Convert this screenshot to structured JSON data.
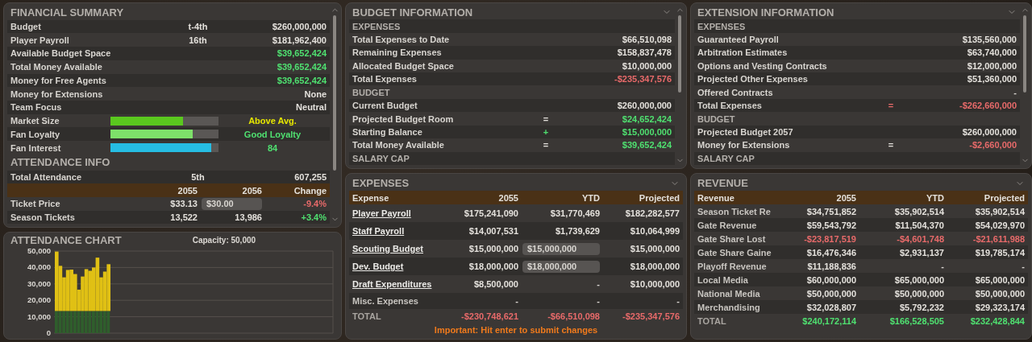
{
  "financial_summary": {
    "title": "FINANCIAL SUMMARY",
    "rows": [
      {
        "kind": "value",
        "label": "Budget",
        "rank": "t-4th",
        "value": "$260,000,000",
        "color": "#e4e1dc"
      },
      {
        "kind": "value",
        "label": "Player Payroll",
        "rank": "16th",
        "value": "$181,962,400",
        "color": "#e4e1dc"
      },
      {
        "kind": "value",
        "label": "Available Budget Space",
        "value": "$39,652,424",
        "color": "#4fe070"
      },
      {
        "kind": "value",
        "label": "Total Money Available",
        "value": "$39,652,424",
        "color": "#4fe070"
      },
      {
        "kind": "value",
        "label": "Money for Free Agents",
        "value": "$39,652,424",
        "color": "#4fe070"
      },
      {
        "kind": "value",
        "label": "Money for Extensions",
        "value": "None",
        "color": "#e4e1dc"
      },
      {
        "kind": "value",
        "label": "Team Focus",
        "value": "Neutral",
        "color": "#e4e1dc"
      },
      {
        "kind": "meter",
        "label": "Market Size",
        "level": 0.67,
        "color": "#5ac81e",
        "rating": {
          "text": "Above Avg.",
          "color": "#e6e600"
        }
      },
      {
        "kind": "meter",
        "label": "Fan Loyalty",
        "level": 0.76,
        "color": "#7ee06a",
        "rating": {
          "text": "Good Loyalty",
          "color": "#4fe070"
        }
      },
      {
        "kind": "meter",
        "label": "Fan Interest",
        "level": 0.93,
        "color": "#26bde3",
        "rating": {
          "text": "84",
          "color": "#4fe070"
        }
      },
      {
        "kind": "section",
        "label": "ATTENDANCE INFO"
      },
      {
        "kind": "value",
        "label": "Total Attendance",
        "rank": "5th",
        "value": "607,255",
        "color": "#e4e1dc"
      }
    ],
    "attendance_table": {
      "columns": [
        "2055",
        "2056",
        "Change"
      ],
      "rows": [
        {
          "label": "Ticket Price",
          "cells": [
            {
              "kind": "text",
              "text": "$33.13",
              "color": "#e4e1dc"
            },
            {
              "kind": "input",
              "text": "$30.00"
            },
            {
              "kind": "text",
              "text": "-9.4%",
              "color": "#e86a6a"
            }
          ]
        },
        {
          "label": "Season Tickets",
          "cells": [
            {
              "kind": "text",
              "text": "13,522",
              "color": "#e4e1dc"
            },
            {
              "kind": "text",
              "text": "13,986",
              "color": "#e4e1dc"
            },
            {
              "kind": "text",
              "text": "+3.4%",
              "color": "#4fe070"
            }
          ]
        }
      ]
    }
  },
  "attendance_chart": {
    "title": "ATTENDANCE CHART",
    "capacity": "Capacity: 50,000",
    "chart_data": {
      "type": "bar",
      "stacked": true,
      "grid": true,
      "ylim": [
        0,
        50000
      ],
      "yticks": [
        {
          "value": 0,
          "label": "0"
        },
        {
          "value": 10000,
          "label": "10,000"
        },
        {
          "value": 20000,
          "label": "20,000"
        },
        {
          "value": 30000,
          "label": "30,000"
        },
        {
          "value": 40000,
          "label": "40,000"
        },
        {
          "value": 50000,
          "label": "50,000"
        }
      ],
      "series": [
        {
          "color": "#2f5e2c",
          "values": [
            13500,
            13500,
            13500,
            13500,
            13500,
            13500,
            13500,
            13500,
            13500,
            13500,
            13500,
            13500,
            13500,
            13500,
            13500
          ]
        },
        {
          "color": "#e0c014",
          "values": [
            36200,
            27500,
            20500,
            25000,
            25200,
            22500,
            13000,
            21000,
            25500,
            24500,
            26500,
            32500,
            20500,
            24000,
            28500
          ]
        }
      ]
    }
  },
  "budget_information": {
    "title": "BUDGET INFORMATION",
    "rows": [
      {
        "kind": "section",
        "label": "EXPENSES"
      },
      {
        "kind": "line",
        "label": "Total Expenses to Date",
        "value": "$66,510,098",
        "color": "#e4e1dc"
      },
      {
        "kind": "line",
        "label": "Remaining Expenses",
        "value": "$158,837,478",
        "color": "#e4e1dc"
      },
      {
        "kind": "line",
        "label": "Allocated Budget Space",
        "value": "$10,000,000",
        "color": "#e4e1dc"
      },
      {
        "kind": "line",
        "label": "Total Expenses",
        "value": "-$235,347,576",
        "color": "#e86a6a"
      },
      {
        "kind": "section",
        "label": "BUDGET"
      },
      {
        "kind": "line",
        "label": "Current Budget",
        "value": "$260,000,000",
        "color": "#e4e1dc"
      },
      {
        "kind": "line",
        "label": "Projected Budget Room",
        "op": {
          "text": "=",
          "color": "#e4e1dc"
        },
        "value": "$24,652,424",
        "color": "#4fe070"
      },
      {
        "kind": "line",
        "label": "Starting Balance",
        "op": {
          "text": "+",
          "color": "#4fe070"
        },
        "value": "$15,000,000",
        "color": "#4fe070"
      },
      {
        "kind": "line",
        "label": "Total Money Available",
        "op": {
          "text": "=",
          "color": "#e4e1dc"
        },
        "value": "$39,652,424",
        "color": "#4fe070"
      },
      {
        "kind": "section",
        "label": "SALARY CAP"
      }
    ]
  },
  "extension_information": {
    "title": "EXTENSION INFORMATION",
    "rows": [
      {
        "kind": "section",
        "label": "EXPENSES"
      },
      {
        "kind": "line",
        "label": "Guaranteed Payroll",
        "value": "$135,560,000",
        "color": "#e4e1dc"
      },
      {
        "kind": "line",
        "label": "Arbitration Estimates",
        "value": "$63,740,000",
        "color": "#e4e1dc"
      },
      {
        "kind": "line",
        "label": "Options and Vesting Contracts",
        "value": "$12,000,000",
        "color": "#e4e1dc"
      },
      {
        "kind": "line",
        "label": "Projected Other Expenses",
        "value": "$51,360,000",
        "color": "#e4e1dc"
      },
      {
        "kind": "line",
        "label": "Offered Contracts",
        "value": "-"
      },
      {
        "kind": "line",
        "label": "Total Expenses",
        "op": {
          "text": "=",
          "color": "#e86a6a"
        },
        "value": "-$262,660,000",
        "color": "#e86a6a"
      },
      {
        "kind": "section",
        "label": "BUDGET"
      },
      {
        "kind": "line",
        "label": "Projected Budget 2057",
        "value": "$260,000,000",
        "color": "#e4e1dc"
      },
      {
        "kind": "line",
        "label": "Money for Extensions",
        "op": {
          "text": "=",
          "color": "#e4e1dc"
        },
        "value": "-$2,660,000",
        "color": "#e86a6a"
      },
      {
        "kind": "section",
        "label": "SALARY CAP"
      }
    ]
  },
  "expenses": {
    "title": "EXPENSES",
    "label_column": "Expense",
    "columns": [
      "2055",
      "YTD",
      "Projected"
    ],
    "rows": [
      {
        "kind": "link",
        "label": "Player Payroll",
        "cells": [
          {
            "kind": "text",
            "text": "$175,241,090",
            "color": "#e4e1dc"
          },
          {
            "kind": "text",
            "text": "$31,770,469",
            "color": "#e4e1dc"
          },
          {
            "kind": "text",
            "text": "$182,282,577",
            "color": "#e4e1dc"
          }
        ]
      },
      {
        "kind": "link",
        "label": "Staff Payroll",
        "cells": [
          {
            "kind": "text",
            "text": "$14,007,531",
            "color": "#e4e1dc"
          },
          {
            "kind": "text",
            "text": "$1,739,629",
            "color": "#e4e1dc"
          },
          {
            "kind": "text",
            "text": "$10,064,999",
            "color": "#e4e1dc"
          }
        ]
      },
      {
        "kind": "link",
        "label": "Scouting Budget",
        "cells": [
          {
            "kind": "text",
            "text": "$15,000,000",
            "color": "#e4e1dc"
          },
          {
            "kind": "input",
            "text": "$15,000,000"
          },
          {
            "kind": "text",
            "text": "$15,000,000",
            "color": "#e4e1dc"
          }
        ]
      },
      {
        "kind": "link",
        "label": "Dev. Budget",
        "cells": [
          {
            "kind": "text",
            "text": "$18,000,000",
            "color": "#e4e1dc"
          },
          {
            "kind": "input",
            "text": "$18,000,000"
          },
          {
            "kind": "text",
            "text": "$18,000,000",
            "color": "#e4e1dc"
          }
        ]
      },
      {
        "kind": "link",
        "label": "Draft Expenditures",
        "cells": [
          {
            "kind": "text",
            "text": "$8,500,000",
            "color": "#e4e1dc"
          },
          {
            "kind": "text",
            "text": "-"
          },
          {
            "kind": "text",
            "text": "$10,000,000",
            "color": "#e4e1dc"
          }
        ]
      },
      {
        "kind": "plain",
        "label": "Misc. Expenses",
        "cells": [
          {
            "kind": "text",
            "text": "-"
          },
          {
            "kind": "text",
            "text": "-"
          },
          {
            "kind": "text",
            "text": "-"
          }
        ]
      },
      {
        "kind": "total",
        "label": "TOTAL",
        "cells": [
          {
            "kind": "text",
            "text": "-$230,748,621",
            "color": "#e86a6a"
          },
          {
            "kind": "text",
            "text": "-$66,510,098",
            "color": "#e86a6a"
          },
          {
            "kind": "text",
            "text": "-$235,347,576",
            "color": "#e86a6a"
          }
        ]
      }
    ],
    "note": "Important: Hit enter to submit changes"
  },
  "revenue": {
    "title": "REVENUE",
    "label_column": "Revenue",
    "columns": [
      "2055",
      "YTD",
      "Projected"
    ],
    "rows": [
      {
        "kind": "plain",
        "label": "Season Ticket Re",
        "cells": [
          {
            "kind": "text",
            "text": "$34,751,852",
            "color": "#e4e1dc"
          },
          {
            "kind": "text",
            "text": "$35,902,514",
            "color": "#e4e1dc"
          },
          {
            "kind": "text",
            "text": "$35,902,514",
            "color": "#e4e1dc"
          }
        ]
      },
      {
        "kind": "plain",
        "label": "Gate Revenue",
        "cells": [
          {
            "kind": "text",
            "text": "$59,543,792",
            "color": "#e4e1dc"
          },
          {
            "kind": "text",
            "text": "$11,504,370",
            "color": "#e4e1dc"
          },
          {
            "kind": "text",
            "text": "$54,029,970",
            "color": "#e4e1dc"
          }
        ]
      },
      {
        "kind": "plain",
        "label": "Gate Share Lost",
        "cells": [
          {
            "kind": "text",
            "text": "-$23,817,519",
            "color": "#e86a6a"
          },
          {
            "kind": "text",
            "text": "-$4,601,748",
            "color": "#e86a6a"
          },
          {
            "kind": "text",
            "text": "-$21,611,988",
            "color": "#e86a6a"
          }
        ]
      },
      {
        "kind": "plain",
        "label": "Gate Share Gaine",
        "cells": [
          {
            "kind": "text",
            "text": "$16,476,346",
            "color": "#e4e1dc"
          },
          {
            "kind": "text",
            "text": "$2,931,137",
            "color": "#e4e1dc"
          },
          {
            "kind": "text",
            "text": "$19,785,174",
            "color": "#e4e1dc"
          }
        ]
      },
      {
        "kind": "plain",
        "label": "Playoff Revenue",
        "cells": [
          {
            "kind": "text",
            "text": "$11,188,836",
            "color": "#e4e1dc"
          },
          {
            "kind": "text",
            "text": "-"
          },
          {
            "kind": "text",
            "text": "-"
          }
        ]
      },
      {
        "kind": "plain",
        "label": "Local Media",
        "cells": [
          {
            "kind": "text",
            "text": "$60,000,000",
            "color": "#e4e1dc"
          },
          {
            "kind": "text",
            "text": "$65,000,000",
            "color": "#e4e1dc"
          },
          {
            "kind": "text",
            "text": "$65,000,000",
            "color": "#e4e1dc"
          }
        ]
      },
      {
        "kind": "plain",
        "label": "National Media",
        "cells": [
          {
            "kind": "text",
            "text": "$50,000,000",
            "color": "#e4e1dc"
          },
          {
            "kind": "text",
            "text": "$50,000,000",
            "color": "#e4e1dc"
          },
          {
            "kind": "text",
            "text": "$50,000,000",
            "color": "#e4e1dc"
          }
        ]
      },
      {
        "kind": "plain",
        "label": "Merchandising",
        "cells": [
          {
            "kind": "text",
            "text": "$32,028,807",
            "color": "#e4e1dc"
          },
          {
            "kind": "text",
            "text": "$5,792,232",
            "color": "#e4e1dc"
          },
          {
            "kind": "text",
            "text": "$29,323,174",
            "color": "#e4e1dc"
          }
        ]
      },
      {
        "kind": "total",
        "label": "TOTAL",
        "cells": [
          {
            "kind": "text",
            "text": "$240,172,114",
            "color": "#4fe070"
          },
          {
            "kind": "text",
            "text": "$166,528,505",
            "color": "#4fe070"
          },
          {
            "kind": "text",
            "text": "$232,428,844",
            "color": "#4fe070"
          }
        ]
      }
    ]
  }
}
